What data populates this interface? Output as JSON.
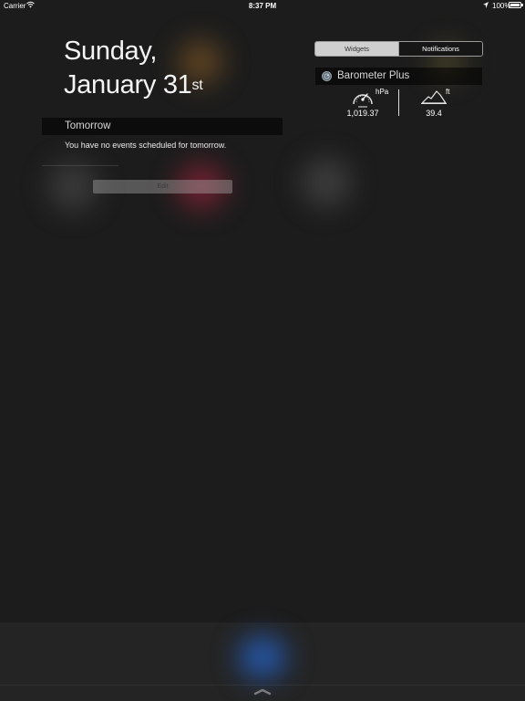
{
  "status_bar": {
    "carrier": "Carrier",
    "time": "8:37 PM",
    "battery_pct": "100%",
    "battery_level": 1.0,
    "icons": [
      "wifi-icon",
      "location-arrow-icon",
      "battery-icon"
    ]
  },
  "date": {
    "line1": "Sunday,",
    "line2_main": "January 31",
    "line2_suffix": "st"
  },
  "today_view": {
    "section_title": "Tomorrow",
    "events_message": "You have no events scheduled for tomorrow.",
    "edit_label": "Edit"
  },
  "tabs": {
    "widgets_label": "Widgets",
    "notifications_label": "Notifications",
    "selected": "Widgets"
  },
  "barometer_widget": {
    "title": "Barometer Plus",
    "pressure_unit": "hPa",
    "pressure_value": "1,019.37",
    "altitude_unit": "ft",
    "altitude_value": "39.4",
    "icons": [
      "barometer-plus-app-icon",
      "gauge-icon",
      "mountain-icon"
    ]
  },
  "colors": {
    "background": "#1c1c1c",
    "segment_selected": "#cfcfcf",
    "text_primary": "#ffffff"
  }
}
